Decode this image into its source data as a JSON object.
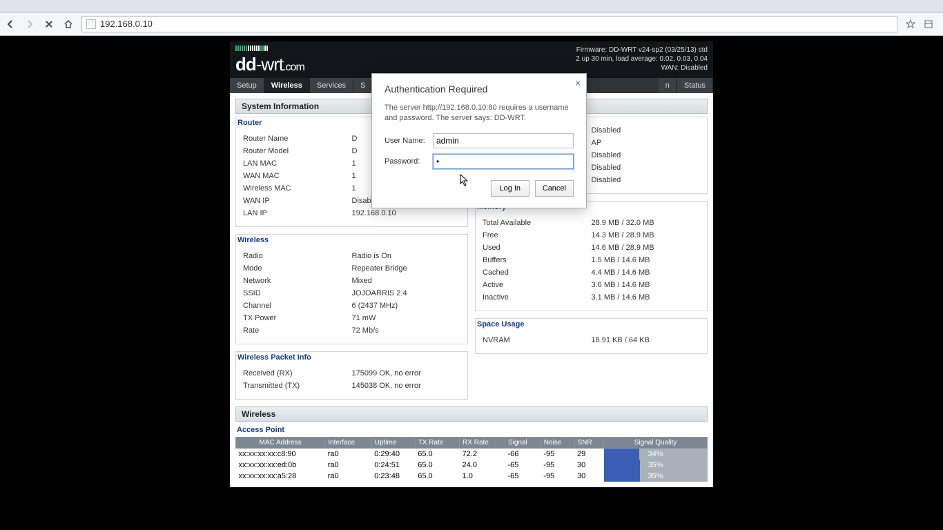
{
  "browser": {
    "url": "192.168.0.10"
  },
  "header": {
    "logo_dd": "dd",
    "logo_wrt": "-wrt",
    "logo_com": ".com",
    "status": {
      "line1": "Firmware: DD-WRT v24-sp2 (03/25/13) std",
      "line2": "2 up 30 min, load average: 0.02, 0.03, 0.04",
      "line3": "WAN: Disabled"
    }
  },
  "nav": {
    "setup": "Setup",
    "wireless": "Wireless",
    "services": "Services",
    "s_partial": "S",
    "n_partial": "n",
    "status": "Status"
  },
  "sysinfo_title": "System Information",
  "router_section": {
    "title": "Router",
    "rows": [
      {
        "k": "Router Name",
        "v": "D"
      },
      {
        "k": "Router Model",
        "v": "D"
      },
      {
        "k": "LAN MAC",
        "v": "1"
      },
      {
        "k": "WAN MAC",
        "v": "1"
      },
      {
        "k": "Wireless MAC",
        "v": "1"
      },
      {
        "k": "WAN IP",
        "v": "Disabled"
      },
      {
        "k": "LAN IP",
        "v": "192.168.0.10"
      }
    ]
  },
  "services_section": {
    "rows": [
      {
        "k": "",
        "v": "Disabled"
      },
      {
        "k": "",
        "v": "AP"
      },
      {
        "k": "",
        "v": "Disabled"
      },
      {
        "k": "",
        "v": "Disabled"
      },
      {
        "k": "",
        "v": "Disabled"
      }
    ]
  },
  "wireless_section": {
    "title": "Wireless",
    "rows": [
      {
        "k": "Radio",
        "v": "Radio is On"
      },
      {
        "k": "Mode",
        "v": "Repeater Bridge"
      },
      {
        "k": "Network",
        "v": "Mixed"
      },
      {
        "k": "SSID",
        "v": "JOJOARRIS 2.4"
      },
      {
        "k": "Channel",
        "v": "6 (2437 MHz)"
      },
      {
        "k": "TX Power",
        "v": "71 mW"
      },
      {
        "k": "Rate",
        "v": "72 Mb/s"
      }
    ]
  },
  "memory_section": {
    "title": "Memory",
    "rows": [
      {
        "k": "Total Available",
        "v": "28.9 MB / 32.0 MB"
      },
      {
        "k": "Free",
        "v": "14.3 MB / 28.9 MB"
      },
      {
        "k": "Used",
        "v": "14.6 MB / 28.9 MB"
      },
      {
        "k": "Buffers",
        "v": "1.5 MB / 14.6 MB"
      },
      {
        "k": "Cached",
        "v": "4.4 MB / 14.6 MB"
      },
      {
        "k": "Active",
        "v": "3.6 MB / 14.6 MB"
      },
      {
        "k": "Inactive",
        "v": "3.1 MB / 14.6 MB"
      }
    ]
  },
  "space_section": {
    "title": "Space Usage",
    "rows": [
      {
        "k": "NVRAM",
        "v": "18.91 KB / 64 KB"
      }
    ]
  },
  "packet_section": {
    "title": "Wireless Packet Info",
    "rows": [
      {
        "k": "Received (RX)",
        "v": "175099 OK, no error"
      },
      {
        "k": "Transmitted (TX)",
        "v": "145038 OK, no error"
      }
    ]
  },
  "wireless_clients": {
    "panel": "Wireless",
    "ap_title": "Access Point",
    "headers": {
      "mac": "MAC Address",
      "if": "Interface",
      "uptime": "Uptime",
      "tx": "TX Rate",
      "rx": "RX Rate",
      "sig": "Signal",
      "noise": "Noise",
      "snr": "SNR",
      "sq": "Signal Quality"
    },
    "rows": [
      {
        "mac": "xx:xx:xx:xx:c8:90",
        "if": "ra0",
        "uptime": "0:29:40",
        "tx": "65.0",
        "rx": "72.2",
        "sig": "-66",
        "noise": "-95",
        "snr": "29",
        "sq": "34%",
        "sqn": 34
      },
      {
        "mac": "xx:xx:xx:xx:ed:0b",
        "if": "ra0",
        "uptime": "0:24:51",
        "tx": "65.0",
        "rx": "24.0",
        "sig": "-65",
        "noise": "-95",
        "snr": "30",
        "sq": "35%",
        "sqn": 35
      },
      {
        "mac": "xx:xx:xx:xx:a5:28",
        "if": "ra0",
        "uptime": "0:23:48",
        "tx": "65.0",
        "rx": "1.0",
        "sig": "-65",
        "noise": "-95",
        "snr": "30",
        "sq": "35%",
        "sqn": 35
      }
    ]
  },
  "dialog": {
    "title": "Authentication Required",
    "text": "The server http://192.168.0.10:80 requires a username and password. The server says: DD-WRT.",
    "user_label": "User Name:",
    "pass_label": "Password:",
    "user_value": "admin",
    "pass_value": "•",
    "login": "Log In",
    "cancel": "Cancel"
  }
}
